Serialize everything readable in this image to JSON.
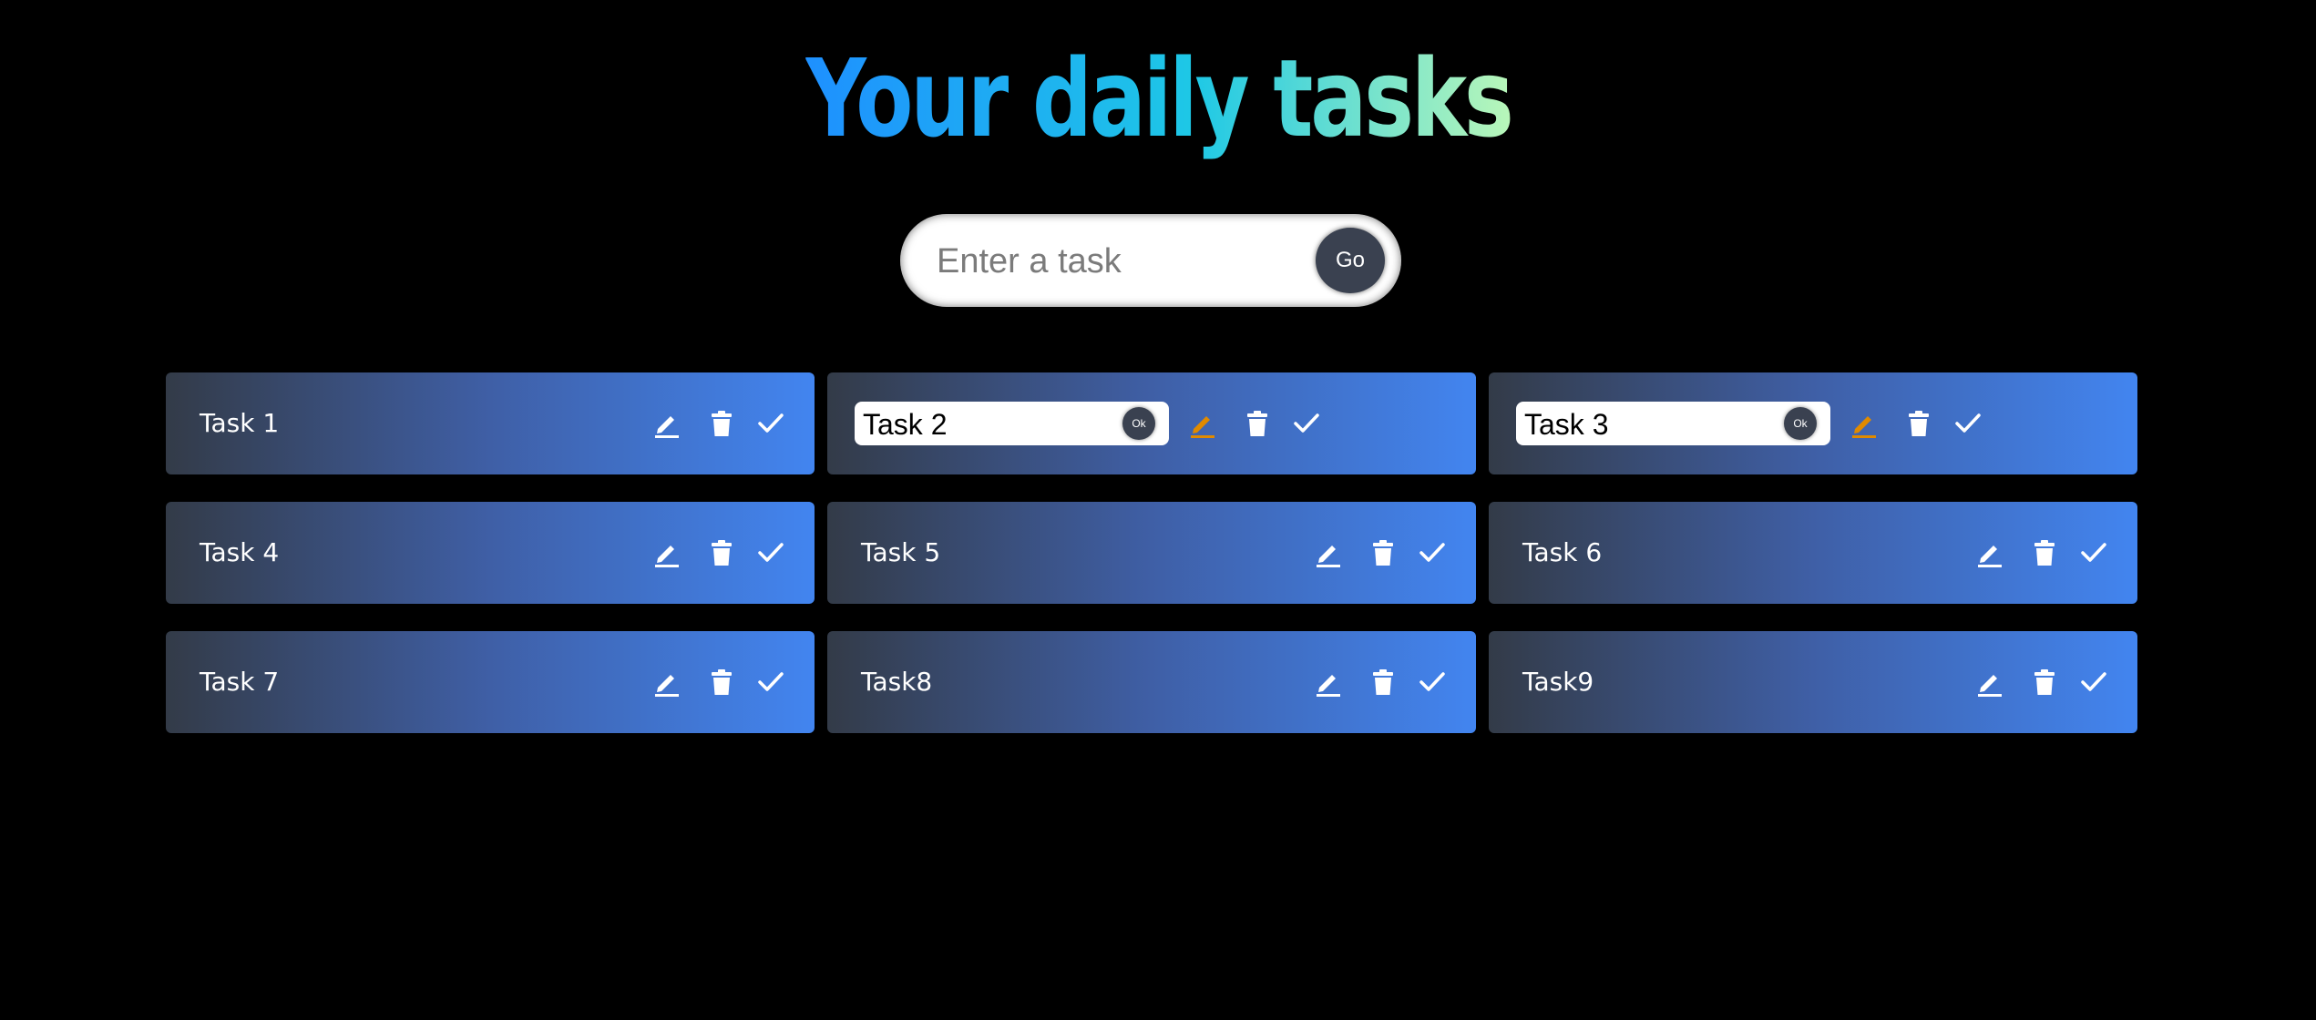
{
  "header": {
    "title": "Your daily tasks"
  },
  "search": {
    "placeholder": "Enter a task",
    "value": "",
    "go_label": "Go"
  },
  "colors": {
    "background": "#000000",
    "title_gradient": [
      "#1e90ff",
      "#1ec8e6",
      "#b9f7b9"
    ],
    "card_gradient": [
      "#333b48",
      "#4285f0"
    ],
    "edit_active": "#e08a00",
    "button": "#3a4150"
  },
  "tasks": [
    {
      "label": "Task 1",
      "editing": false
    },
    {
      "label": "Task 2",
      "editing": true,
      "edit_value": "Task 2",
      "ok_label": "Ok"
    },
    {
      "label": "Task 3",
      "editing": true,
      "edit_value": "Task 3",
      "ok_label": "Ok"
    },
    {
      "label": "Task 4",
      "editing": false
    },
    {
      "label": "Task 5",
      "editing": false
    },
    {
      "label": "Task 6",
      "editing": false
    },
    {
      "label": "Task 7",
      "editing": false
    },
    {
      "label": "Task8",
      "editing": false
    },
    {
      "label": "Task9",
      "editing": false
    }
  ],
  "icons": {
    "edit": "pencil-icon",
    "delete": "trash-icon",
    "complete": "check-icon"
  }
}
